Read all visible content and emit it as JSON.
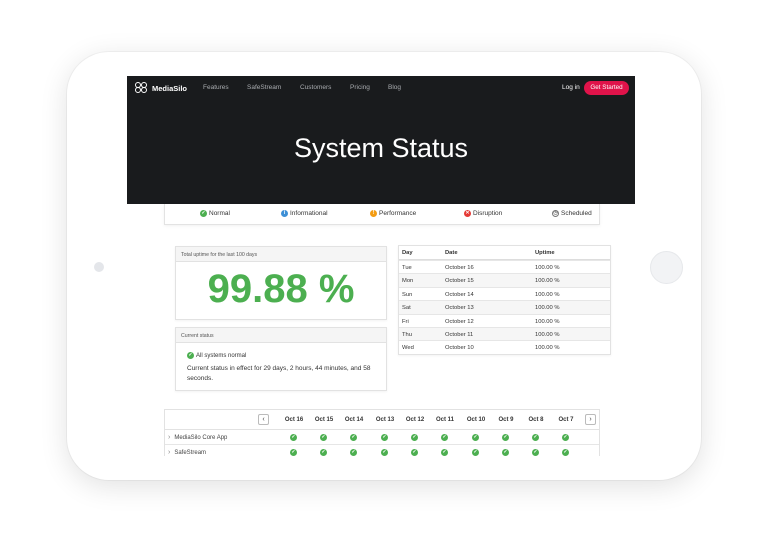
{
  "nav": {
    "brand": "MediaSilo",
    "links": [
      "Features",
      "SafeStream",
      "Customers",
      "Pricing",
      "Blog"
    ],
    "login": "Log in",
    "cta": "Get Started"
  },
  "hero": {
    "title": "System Status"
  },
  "legend": [
    {
      "label": "Normal",
      "icon": "check-icon",
      "color": "#4caf50",
      "glyph": "✓"
    },
    {
      "label": "Informational",
      "icon": "info-icon",
      "color": "#3d8fd6",
      "glyph": "i"
    },
    {
      "label": "Performance",
      "icon": "warning-icon",
      "color": "#f39c12",
      "glyph": "!"
    },
    {
      "label": "Disruption",
      "icon": "x-icon",
      "color": "#e53935",
      "glyph": "✕"
    },
    {
      "label": "Scheduled",
      "icon": "clock-icon",
      "color": "#777777",
      "glyph": "◷"
    }
  ],
  "uptime": {
    "header": "Total uptime for the last 100 days",
    "value": "99.88 %"
  },
  "current_status": {
    "header": "Current status",
    "summary": "All systems normal",
    "detail": "Current status in effect for 29 days, 2 hours, 44 minutes, and 58 seconds."
  },
  "history": {
    "columns": [
      "Day",
      "Date",
      "Uptime"
    ],
    "rows": [
      [
        "Tue",
        "October 16",
        "100.00 %"
      ],
      [
        "Mon",
        "October 15",
        "100.00 %"
      ],
      [
        "Sun",
        "October 14",
        "100.00 %"
      ],
      [
        "Sat",
        "October 13",
        "100.00 %"
      ],
      [
        "Fri",
        "October 12",
        "100.00 %"
      ],
      [
        "Thu",
        "October 11",
        "100.00 %"
      ],
      [
        "Wed",
        "October 10",
        "100.00 %"
      ]
    ]
  },
  "services": {
    "days": [
      "Oct 16",
      "Oct 15",
      "Oct 14",
      "Oct 13",
      "Oct 12",
      "Oct 11",
      "Oct 10",
      "Oct 9",
      "Oct 8",
      "Oct 7"
    ],
    "prev_arrow": "‹",
    "next_arrow": "›",
    "rows": [
      {
        "name": "MediaSilo Core App",
        "status": [
          "normal",
          "normal",
          "normal",
          "normal",
          "normal",
          "normal",
          "normal",
          "normal",
          "normal",
          "normal"
        ]
      },
      {
        "name": "SafeStream",
        "status": [
          "normal",
          "normal",
          "normal",
          "normal",
          "normal",
          "normal",
          "normal",
          "normal",
          "normal",
          "normal"
        ]
      }
    ]
  }
}
